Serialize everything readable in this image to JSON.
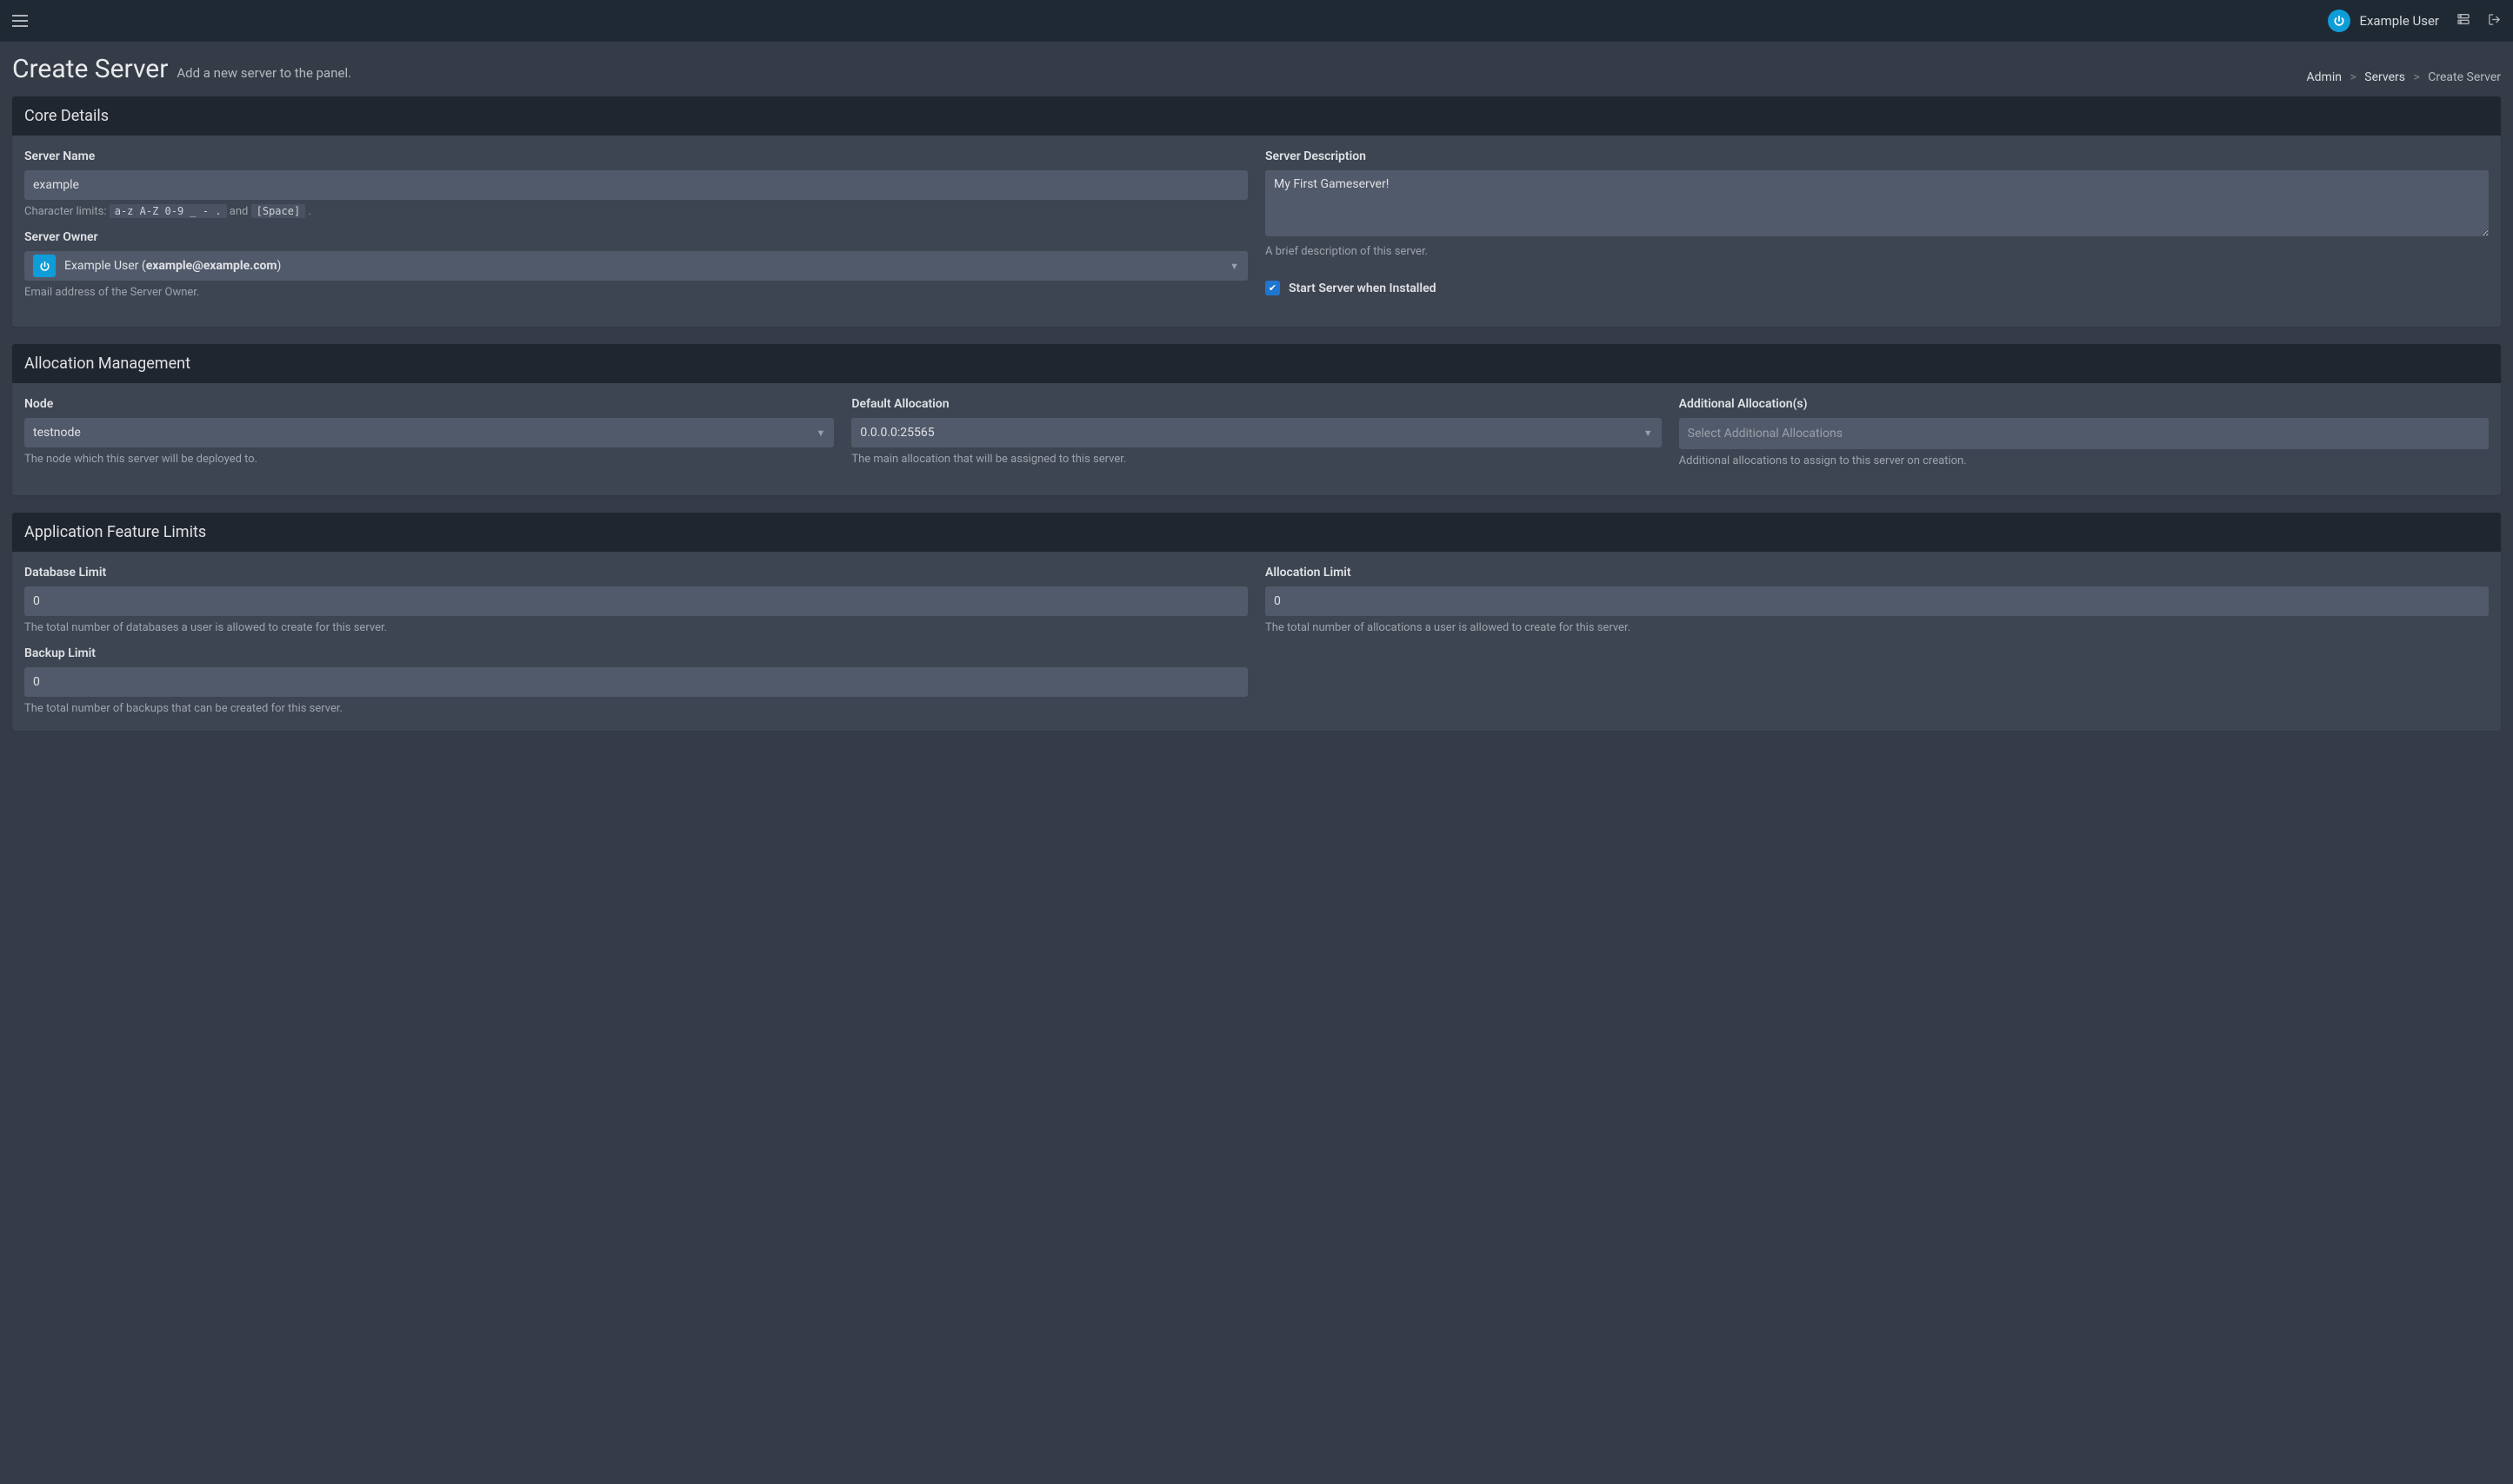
{
  "topbar": {
    "username": "Example User"
  },
  "header": {
    "title": "Create Server",
    "subtitle": "Add a new server to the panel."
  },
  "breadcrumbs": {
    "admin": "Admin",
    "servers": "Servers",
    "current": "Create Server"
  },
  "core": {
    "title": "Core Details",
    "server_name_label": "Server Name",
    "server_name_value": "example",
    "char_limits_prefix": "Character limits:",
    "char_limits_code1": "a-z A-Z 0-9 _ - .",
    "char_limits_and": "and",
    "char_limits_code2": "[Space]",
    "char_limits_suffix": ".",
    "server_owner_label": "Server Owner",
    "server_owner_display": "Example User (",
    "server_owner_email": "example@example.com",
    "server_owner_display_suffix": ")",
    "server_owner_help": "Email address of the Server Owner.",
    "server_desc_label": "Server Description",
    "server_desc_value": "My First Gameserver!",
    "server_desc_help": "A brief description of this server.",
    "start_when_installed_label": "Start Server when Installed"
  },
  "alloc": {
    "title": "Allocation Management",
    "node_label": "Node",
    "node_value": "testnode",
    "node_help": "The node which this server will be deployed to.",
    "default_alloc_label": "Default Allocation",
    "default_alloc_value": "0.0.0.0:25565",
    "default_alloc_help": "The main allocation that will be assigned to this server.",
    "additional_label": "Additional Allocation(s)",
    "additional_placeholder": "Select Additional Allocations",
    "additional_help": "Additional allocations to assign to this server on creation."
  },
  "limits": {
    "title": "Application Feature Limits",
    "db_label": "Database Limit",
    "db_value": "0",
    "db_help": "The total number of databases a user is allowed to create for this server.",
    "alloc_label": "Allocation Limit",
    "alloc_value": "0",
    "alloc_help": "The total number of allocations a user is allowed to create for this server.",
    "backup_label": "Backup Limit",
    "backup_value": "0",
    "backup_help": "The total number of backups that can be created for this server."
  }
}
